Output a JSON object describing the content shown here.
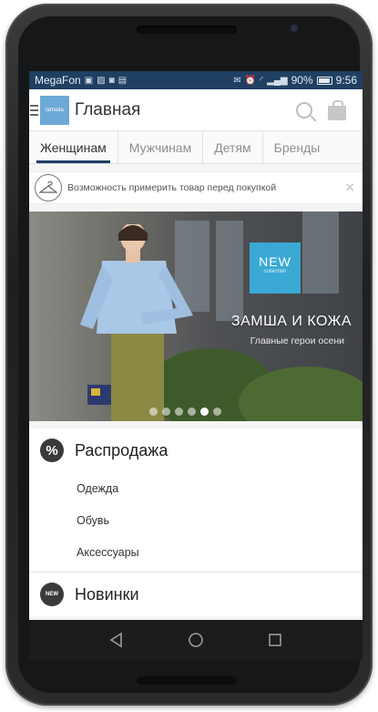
{
  "status_bar": {
    "carrier": "MegaFon",
    "battery": "90%",
    "time": "9:56"
  },
  "app_bar": {
    "logo_text": "lamoda",
    "title": "Главная"
  },
  "tabs": [
    {
      "label": "Женщинам",
      "active": true
    },
    {
      "label": "Мужчинам",
      "active": false
    },
    {
      "label": "Детям",
      "active": false
    },
    {
      "label": "Бренды",
      "active": false
    }
  ],
  "notice": {
    "text": "Возможность примерить товар перед покупкой"
  },
  "banner": {
    "badge_title": "NEW",
    "badge_subtitle": "collection",
    "title": "ЗАМША И КОЖА",
    "subtitle": "Главные герои осени",
    "slide_count": 6,
    "active_slide": 5
  },
  "menu": {
    "sale": {
      "icon": "%",
      "title": "Распродажа",
      "items": [
        "Одежда",
        "Обувь",
        "Аксессуары"
      ]
    },
    "new": {
      "icon": "NEW",
      "title": "Новинки"
    }
  },
  "colors": {
    "status_bar": "#1f3f63",
    "accent": "#1f3f63",
    "badge": "#3aa9d4",
    "logo": "#6da9d7"
  }
}
